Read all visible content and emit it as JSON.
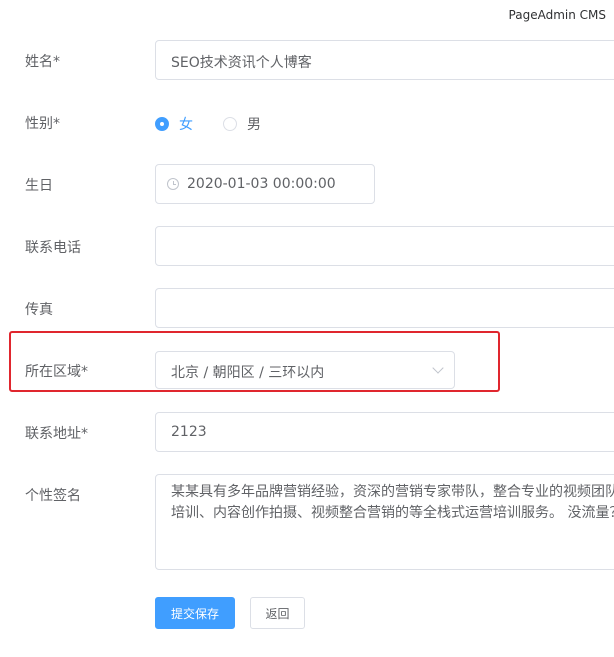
{
  "header": {
    "brand": "PageAdmin CMS"
  },
  "form": {
    "name": {
      "label": "姓名*",
      "value": "SEO技术资讯个人博客"
    },
    "gender": {
      "label": "性别*",
      "options": [
        "女",
        "男"
      ],
      "selected": "女"
    },
    "birthday": {
      "label": "生日",
      "value": "2020-01-03 00:00:00"
    },
    "phone": {
      "label": "联系电话",
      "value": ""
    },
    "fax": {
      "label": "传真",
      "value": ""
    },
    "region": {
      "label": "所在区域*",
      "value": "北京 / 朝阳区 / 三环以内"
    },
    "address": {
      "label": "联系地址*",
      "value": "2123"
    },
    "signature": {
      "label": "个性签名",
      "line1": "某某具有多年品牌营销经验，资深的营销专家带队，整合专业的视频团队",
      "line2": "培训、内容创作拍摄、视频整合营销的等全栈式运营培训服务。 没流量？"
    }
  },
  "actions": {
    "submit_label": "提交保存",
    "back_label": "返回"
  },
  "colors": {
    "primary": "#409eff",
    "highlight": "#e0262e",
    "border": "#dcdfe6"
  }
}
